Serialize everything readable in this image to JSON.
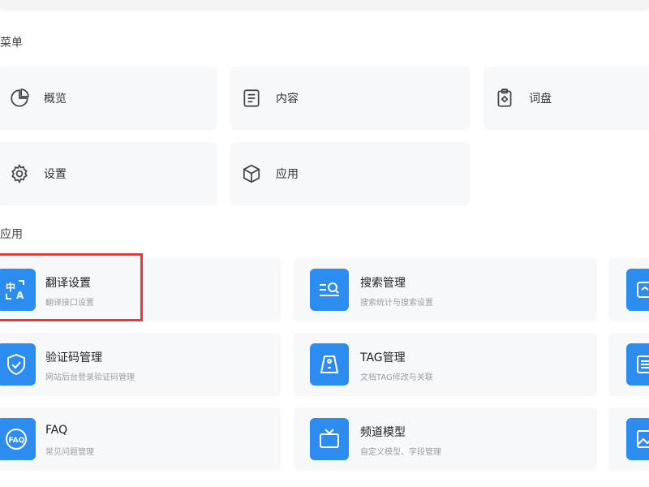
{
  "menu": {
    "title": "菜单",
    "items": [
      {
        "label": "概览",
        "icon": "pie-chart-icon"
      },
      {
        "label": "内容",
        "icon": "document-icon"
      },
      {
        "label": "词盘",
        "icon": "clipboard-icon"
      },
      {
        "label": "设置",
        "icon": "gear-icon"
      },
      {
        "label": "应用",
        "icon": "cube-icon"
      }
    ]
  },
  "apps": {
    "title": "应用",
    "items": [
      {
        "title": "翻译设置",
        "desc": "翻译接口设置",
        "icon": "translate-icon"
      },
      {
        "title": "搜索管理",
        "desc": "搜索统计与搜索设置",
        "icon": "search-list-icon"
      },
      {
        "title": "验证码管理",
        "desc": "网站后台登录验证码管理",
        "icon": "shield-check-icon"
      },
      {
        "title": "TAG管理",
        "desc": "文档TAG修改与关联",
        "icon": "tag-icon"
      },
      {
        "title": "FAQ",
        "desc": "常见问题管理",
        "icon": "faq-icon"
      },
      {
        "title": "频道模型",
        "desc": "自定义模型、字段管理",
        "icon": "tv-icon"
      }
    ]
  },
  "colors": {
    "accent": "#2d8cf0",
    "card_bg": "#f7f8fa",
    "highlight": "#e03c3c"
  }
}
